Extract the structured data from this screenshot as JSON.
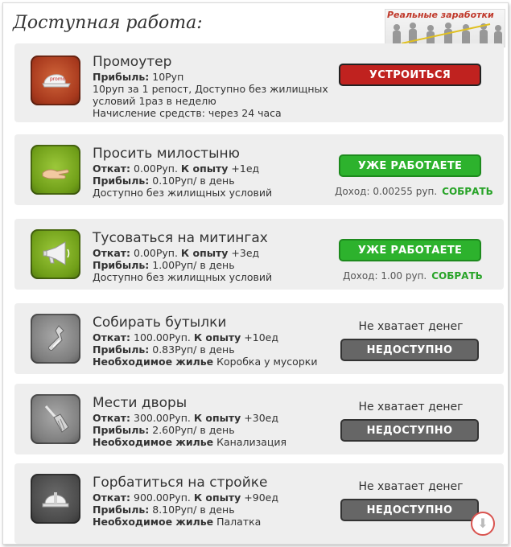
{
  "page": {
    "title": "Доступная работа:"
  },
  "banner": {
    "text": "Реальные заработки"
  },
  "jobs": [
    {
      "title": "Промоутер",
      "line1_label": "Прибыль:",
      "line1_value": " 10Руп",
      "line2": "10руп за 1 репост, Доступно без жилищных",
      "line3": "условий 1раз в неделю",
      "line4": "Начисление средств: через 24 часа",
      "button": "УСТРОИТЬСЯ",
      "icon": "cap-icon",
      "accent": "#b23a22"
    },
    {
      "title": "Просить милостыню",
      "line1_label": "Откат:",
      "line1_value": " 0.00Руп.",
      "line1_label2": "К опыту",
      "line1_value2": " +1ед",
      "line2_label": "Прибыль:",
      "line2_value": " 0.10Руп/ в день",
      "line3": "Доступно без жилищных условий",
      "button": "УЖЕ РАБОТАЕТЕ",
      "income": "Доход: 0.00255 руп.",
      "collect": "СОБРАТЬ",
      "icon": "begging-hand-icon",
      "accent": "#7cae1e"
    },
    {
      "title": "Тусоваться на митингах",
      "line1_label": "Откат:",
      "line1_value": " 0.00Руп.",
      "line1_label2": "К опыту",
      "line1_value2": " +3ед",
      "line2_label": "Прибыль:",
      "line2_value": " 1.00Руп/ в день",
      "line3": "Доступно без жилищных условий",
      "button": "УЖЕ РАБОТАЕТЕ",
      "income": "Доход: 1.00 руп.",
      "collect": "СОБРАТЬ",
      "icon": "megaphone-icon",
      "accent": "#7cae1e"
    },
    {
      "title": "Собирать бутылки",
      "line1_label": "Откат:",
      "line1_value": " 100.00Руп.",
      "line1_label2": "К опыту",
      "line1_value2": " +10ед",
      "line2_label": "Прибыль:",
      "line2_value": " 0.83Руп/ в день",
      "line3_label": "Необходимое жилье",
      "line3_value": " Коробка у мусорки",
      "status": "Не хватает денег",
      "button": "НЕДОСТУПНО",
      "icon": "bottle-icon",
      "accent": "#8a8a8a"
    },
    {
      "title": "Мести дворы",
      "line1_label": "Откат:",
      "line1_value": " 300.00Руп.",
      "line1_label2": "К опыту",
      "line1_value2": " +30ед",
      "line2_label": "Прибыль:",
      "line2_value": " 2.60Руп/ в день",
      "line3_label": "Необходимое жилье",
      "line3_value": " Канализация",
      "status": "Не хватает денег",
      "button": "НЕДОСТУПНО",
      "icon": "broom-icon",
      "accent": "#8a8a8a"
    },
    {
      "title": "Горбатиться на стройке",
      "line1_label": "Откат:",
      "line1_value": " 900.00Руп.",
      "line1_label2": "К опыту",
      "line1_value2": " +90ед",
      "line2_label": "Прибыль:",
      "line2_value": " 8.10Руп/ в день",
      "line3_label": "Необходимое жилье",
      "line3_value": " Палатка",
      "status": "Не хватает денег",
      "button": "НЕДОСТУПНО",
      "icon": "hard-hat-icon",
      "accent": "#5a5a5a"
    }
  ],
  "scroll": {
    "icon": "arrow-down-icon",
    "glyph": "⬇"
  }
}
